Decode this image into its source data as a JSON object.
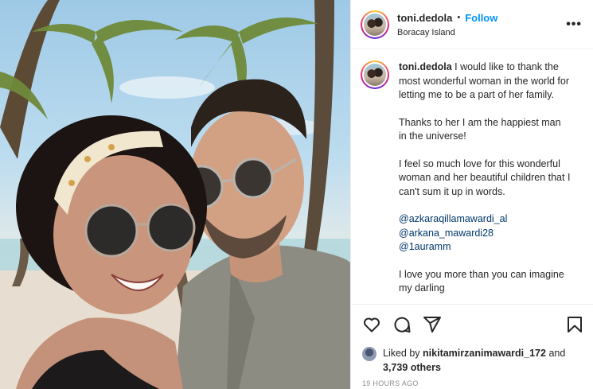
{
  "post": {
    "username": "toni.dedola",
    "separator": "•",
    "follow_label": "Follow",
    "location": "Boracay Island",
    "more_icon": "more-horizontal-icon",
    "more_label": "•••"
  },
  "caption": {
    "username": "toni.dedola",
    "paragraphs": [
      "I would like to thank the most wonderful woman in the world for letting me to be a part of her family.",
      "Thanks to her I am the happiest man in the universe!",
      "I feel so much love for this wonderful woman and her beautiful children that I can't sum it up in words."
    ],
    "mentions": [
      "@azkaraqillamawardi_al",
      "@arkana_mawardi28",
      "@1auramm"
    ],
    "closing": "I love you more than you can imagine my darling"
  },
  "actions": {
    "icons": [
      "heart-icon",
      "comment-icon",
      "share-icon",
      "bookmark-icon"
    ]
  },
  "likes": {
    "prefix": "Liked by ",
    "user": "nikitamirzanimawardi_172",
    "connector": " and",
    "others": "3,739 others"
  },
  "timestamp": "19 HOURS AGO",
  "colors": {
    "link": "#0095f6",
    "mention": "#00376b",
    "muted": "#8e8e8e",
    "border": "#efefef"
  }
}
